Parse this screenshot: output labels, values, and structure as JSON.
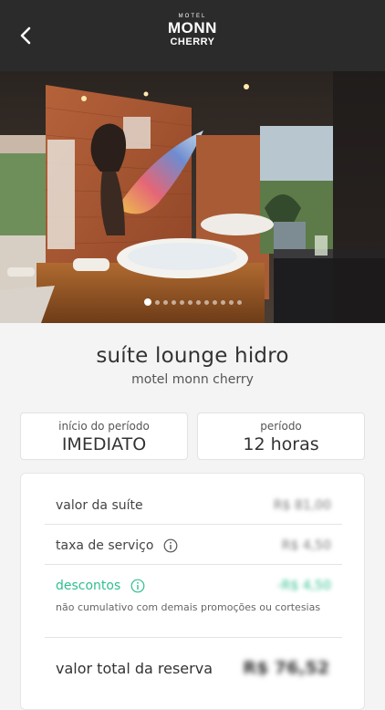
{
  "header": {
    "logo": {
      "line1": "MOTEL",
      "line2": "MONN",
      "line3": "CHERRY"
    }
  },
  "carousel": {
    "total": 12,
    "active": 1
  },
  "suite": {
    "name": "suíte lounge hidro",
    "motel": "motel monn cherry"
  },
  "period": {
    "start_label": "início do período",
    "start_value": "IMEDIATO",
    "duration_label": "período",
    "duration_value": "12 horas"
  },
  "summary": {
    "suite_label": "valor da suíte",
    "suite_value": "R$ 81,00",
    "fee_label": "taxa de serviço",
    "fee_value": "R$ 4,50",
    "discount_label": "descontos",
    "discount_value": "-R$ 4,50",
    "discount_note": "não cumulativo com demais promoções ou cortesias",
    "total_label": "valor total da reserva",
    "total_value": "R$ 76,52"
  },
  "colors": {
    "header_bg": "#2b2b2b",
    "accent_green": "#2fbf8f"
  }
}
